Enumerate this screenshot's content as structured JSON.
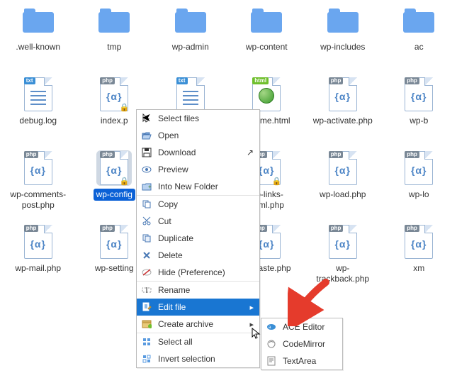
{
  "files": [
    {
      "name": ".well-known",
      "type": "folder"
    },
    {
      "name": "tmp",
      "type": "folder"
    },
    {
      "name": "wp-admin",
      "type": "folder"
    },
    {
      "name": "wp-content",
      "type": "folder"
    },
    {
      "name": "wp-includes",
      "type": "folder"
    },
    {
      "name": "ac",
      "type": "folder-cut"
    },
    {
      "name": "debug.log",
      "type": "txt"
    },
    {
      "name": "index.p",
      "type": "php-lock"
    },
    {
      "name": "",
      "type": "txt"
    },
    {
      "name": "readme.html",
      "type": "html"
    },
    {
      "name": "wp-activate.php",
      "type": "php"
    },
    {
      "name": "wp-b",
      "type": "php-cut"
    },
    {
      "name": "wp-comments-post.php",
      "type": "php"
    },
    {
      "name": "wp-config",
      "type": "php-lock",
      "selected": true
    },
    {
      "name": "",
      "type": "blank"
    },
    {
      "name": "wp-links-opml.php",
      "type": "php-lock"
    },
    {
      "name": "wp-load.php",
      "type": "php"
    },
    {
      "name": "wp-lo",
      "type": "php-cut"
    },
    {
      "name": "wp-mail.php",
      "type": "php"
    },
    {
      "name": "wp-setting",
      "type": "php"
    },
    {
      "name": "",
      "type": "blank"
    },
    {
      "name": "wp-taste.php",
      "type": "php"
    },
    {
      "name": "wp-trackback.php",
      "type": "php"
    },
    {
      "name": "xm",
      "type": "php-cut"
    }
  ],
  "badges": {
    "php": "php",
    "txt": "txt",
    "html": "html"
  },
  "menu": {
    "select_files": "Select files",
    "open": "Open",
    "download": "Download",
    "preview": "Preview",
    "into_new_folder": "Into New Folder",
    "copy": "Copy",
    "cut": "Cut",
    "duplicate": "Duplicate",
    "delete": "Delete",
    "hide_pref": "Hide (Preference)",
    "rename": "Rename",
    "edit_file": "Edit file",
    "create_archive": "Create archive",
    "select_all": "Select all",
    "invert_selection": "Invert selection"
  },
  "submenu": {
    "ace": "ACE Editor",
    "codemirror": "CodeMirror",
    "textarea": "TextArea"
  }
}
